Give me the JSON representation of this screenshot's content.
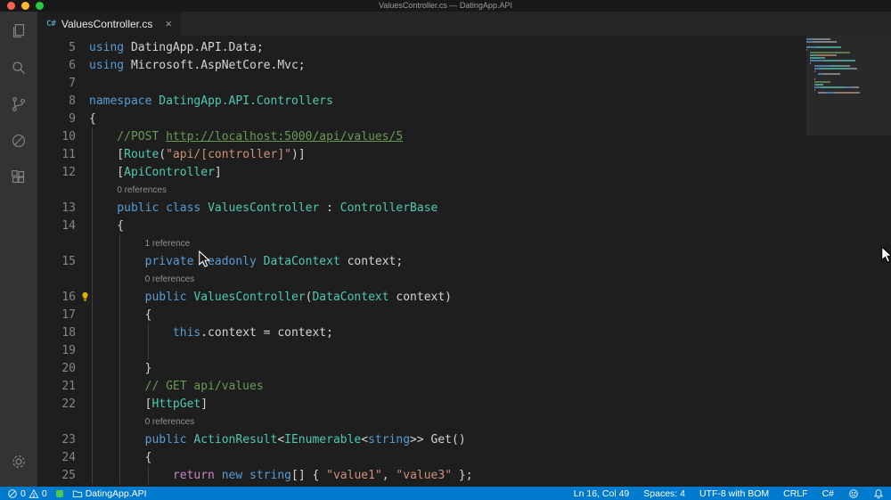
{
  "window": {
    "title": "ValuesController.cs — DatingApp.API"
  },
  "tab": {
    "icon": "C#",
    "label": "ValuesController.cs",
    "close": "×"
  },
  "activity_bar": {
    "items": [
      "explorer",
      "search",
      "source-control",
      "debug",
      "extensions"
    ],
    "bottom": "settings"
  },
  "editor": {
    "lines": [
      {
        "kind": "code",
        "num": "5",
        "tokens": [
          [
            "kw",
            "using "
          ],
          [
            "plain",
            "DatingApp.API.Data;"
          ]
        ]
      },
      {
        "kind": "code",
        "num": "6",
        "tokens": [
          [
            "kw",
            "using "
          ],
          [
            "plain",
            "Microsoft.AspNetCore.Mvc;"
          ]
        ]
      },
      {
        "kind": "code",
        "num": "7",
        "tokens": []
      },
      {
        "kind": "code",
        "num": "8",
        "tokens": [
          [
            "kw",
            "namespace "
          ],
          [
            "type",
            "DatingApp.API.Controllers"
          ]
        ]
      },
      {
        "kind": "code",
        "num": "9",
        "tokens": [
          [
            "plain",
            "{"
          ]
        ]
      },
      {
        "kind": "code",
        "num": "10",
        "tokens": [
          [
            "comment",
            "    //POST "
          ],
          [
            "link",
            "http://localhost:5000/api/values/5"
          ]
        ]
      },
      {
        "kind": "code",
        "num": "11",
        "tokens": [
          [
            "plain",
            "    ["
          ],
          [
            "type",
            "Route"
          ],
          [
            "plain",
            "("
          ],
          [
            "str",
            "\"api/[controller]\""
          ],
          [
            "plain",
            ")]"
          ]
        ]
      },
      {
        "kind": "code",
        "num": "12",
        "tokens": [
          [
            "plain",
            "    ["
          ],
          [
            "type",
            "ApiController"
          ],
          [
            "plain",
            "]"
          ]
        ]
      },
      {
        "kind": "lens",
        "text": "0 references",
        "indent": 4
      },
      {
        "kind": "code",
        "num": "13",
        "tokens": [
          [
            "kw",
            "    public class "
          ],
          [
            "type",
            "ValuesController"
          ],
          [
            "plain",
            " : "
          ],
          [
            "type",
            "ControllerBase"
          ]
        ]
      },
      {
        "kind": "code",
        "num": "14",
        "tokens": [
          [
            "plain",
            "    {"
          ]
        ]
      },
      {
        "kind": "lens",
        "text": "1 reference",
        "indent": 8
      },
      {
        "kind": "code",
        "num": "15",
        "tokens": [
          [
            "kw",
            "        private readonly "
          ],
          [
            "type",
            "DataContext"
          ],
          [
            "plain",
            " context;"
          ]
        ]
      },
      {
        "kind": "lens",
        "text": "0 references",
        "indent": 8
      },
      {
        "kind": "code",
        "num": "16",
        "lightbulb": true,
        "tokens": [
          [
            "kw",
            "        public "
          ],
          [
            "type",
            "ValuesController"
          ],
          [
            "plain",
            "("
          ],
          [
            "type",
            "DataContext"
          ],
          [
            "plain",
            " context)"
          ]
        ]
      },
      {
        "kind": "code",
        "num": "17",
        "tokens": [
          [
            "plain",
            "        {"
          ]
        ]
      },
      {
        "kind": "code",
        "num": "18",
        "tokens": [
          [
            "kw",
            "            this"
          ],
          [
            "plain",
            ".context = context;"
          ]
        ]
      },
      {
        "kind": "code",
        "num": "19",
        "tokens": []
      },
      {
        "kind": "code",
        "num": "20",
        "tokens": [
          [
            "plain",
            "        }"
          ]
        ]
      },
      {
        "kind": "code",
        "num": "21",
        "tokens": [
          [
            "comment",
            "        // GET api/values"
          ]
        ]
      },
      {
        "kind": "code",
        "num": "22",
        "tokens": [
          [
            "plain",
            "        ["
          ],
          [
            "type",
            "HttpGet"
          ],
          [
            "plain",
            "]"
          ]
        ]
      },
      {
        "kind": "lens",
        "text": "0 references",
        "indent": 8
      },
      {
        "kind": "code",
        "num": "23",
        "tokens": [
          [
            "kw",
            "        public "
          ],
          [
            "type",
            "ActionResult"
          ],
          [
            "plain",
            "<"
          ],
          [
            "type",
            "IEnumerable"
          ],
          [
            "plain",
            "<"
          ],
          [
            "kw",
            "string"
          ],
          [
            "plain",
            ">> Get()"
          ]
        ]
      },
      {
        "kind": "code",
        "num": "24",
        "tokens": [
          [
            "plain",
            "        {"
          ]
        ]
      },
      {
        "kind": "code",
        "num": "25",
        "tokens": [
          [
            "ctrl",
            "            return "
          ],
          [
            "kw",
            "new string"
          ],
          [
            "plain",
            "[] { "
          ],
          [
            "str",
            "\"value1\""
          ],
          [
            "plain",
            ", "
          ],
          [
            "str",
            "\"value3\""
          ],
          [
            "plain",
            " };"
          ]
        ]
      }
    ]
  },
  "status_bar": {
    "errors": "0",
    "warnings": "0",
    "folder": "DatingApp.API",
    "cursor": "Ln 16, Col 49",
    "indent": "Spaces: 4",
    "encoding": "UTF-8 with BOM",
    "eol": "CRLF",
    "language": "C#"
  },
  "colors": {
    "background": "#1e1e1e",
    "activity_bar": "#333333",
    "tab_bar": "#252526",
    "status_bar": "#007acc",
    "keyword": "#569cd6",
    "control_keyword": "#c586c0",
    "type": "#4ec9b0",
    "string": "#ce9178",
    "comment": "#6a9955",
    "text": "#d4d4d4",
    "line_number": "#858585",
    "codelens": "#8f8f8f"
  }
}
